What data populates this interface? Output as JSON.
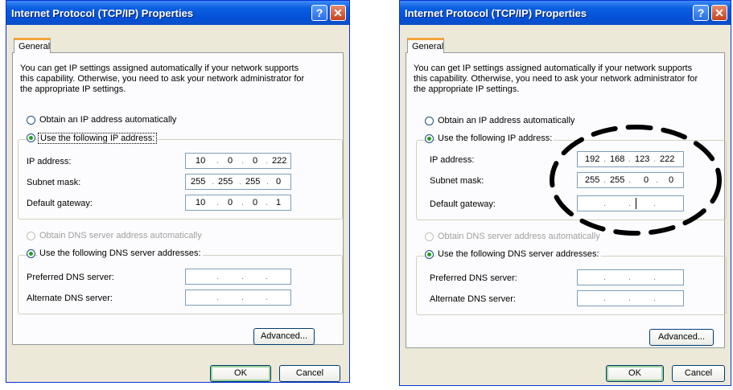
{
  "left_dialog": {
    "title": "Internet Protocol (TCP/IP) Properties",
    "help_glyph": "?",
    "close_glyph": "✕",
    "tab_general": "General",
    "intro_line1": "You can get IP settings assigned automatically if your network supports",
    "intro_line2": "this capability. Otherwise, you need to ask your network administrator for",
    "intro_line3": "the appropriate IP settings.",
    "radio_obtain_ip": "Obtain an IP address automatically",
    "radio_use_ip": "Use the following IP address:",
    "ip_label": "IP address:",
    "ip_value": [
      "10",
      "0",
      "0",
      "222"
    ],
    "subnet_label": "Subnet mask:",
    "subnet_value": [
      "255",
      "255",
      "255",
      "0"
    ],
    "gateway_label": "Default gateway:",
    "gateway_value": [
      "10",
      "0",
      "0",
      "1"
    ],
    "radio_obtain_dns": "Obtain DNS server address automatically",
    "radio_use_dns": "Use the following DNS server addresses:",
    "preferred_dns_label": "Preferred DNS server:",
    "alternate_dns_label": "Alternate DNS server:",
    "advanced_button": "Advanced...",
    "ok_button": "OK",
    "cancel_button": "Cancel"
  },
  "right_dialog": {
    "title": "Internet Protocol (TCP/IP) Properties",
    "help_glyph": "?",
    "close_glyph": "✕",
    "tab_general": "General",
    "intro_line1": "You can get IP settings assigned automatically if your network supports",
    "intro_line2": "this capability. Otherwise, you need to ask your network administrator for",
    "intro_line3": "the appropriate IP settings.",
    "radio_obtain_ip": "Obtain an IP address automatically",
    "radio_use_ip": "Use the following IP address:",
    "ip_label": "IP address:",
    "ip_value": [
      "192",
      "168",
      "123",
      "222"
    ],
    "subnet_label": "Subnet mask:",
    "subnet_value": [
      "255",
      "255",
      "0",
      "0"
    ],
    "gateway_label": "Default gateway:",
    "radio_obtain_dns": "Obtain DNS server address automatically",
    "radio_use_dns": "Use the following DNS server addresses:",
    "preferred_dns_label": "Preferred DNS server:",
    "alternate_dns_label": "Alternate DNS server:",
    "advanced_button": "Advanced...",
    "ok_button": "OK",
    "cancel_button": "Cancel"
  },
  "colors": {
    "titlebar": "#0451d8",
    "dialog_bg": "#ece9d8",
    "radio_selected": "#21a121",
    "highlight_dashes": "#000000"
  }
}
